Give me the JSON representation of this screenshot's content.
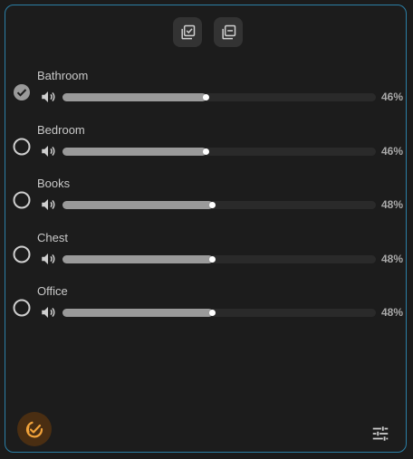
{
  "toolbar": {
    "select_all_icon": "select-all-icon",
    "deselect_all_icon": "deselect-all-icon"
  },
  "rooms": [
    {
      "name": "Bathroom",
      "selected": true,
      "volume": 46,
      "volume_label": "46%"
    },
    {
      "name": "Bedroom",
      "selected": false,
      "volume": 46,
      "volume_label": "46%"
    },
    {
      "name": "Books",
      "selected": false,
      "volume": 48,
      "volume_label": "48%"
    },
    {
      "name": "Chest",
      "selected": false,
      "volume": 48,
      "volume_label": "48%"
    },
    {
      "name": "Office",
      "selected": false,
      "volume": 48,
      "volume_label": "48%"
    }
  ],
  "footer": {
    "group_icon": "group-check-icon",
    "settings_icon": "tune-icon"
  },
  "colors": {
    "accent": "#f2a33a",
    "border": "#2b7fa6",
    "slider_fill": "#9a9a9a",
    "background": "#1c1c1c"
  }
}
